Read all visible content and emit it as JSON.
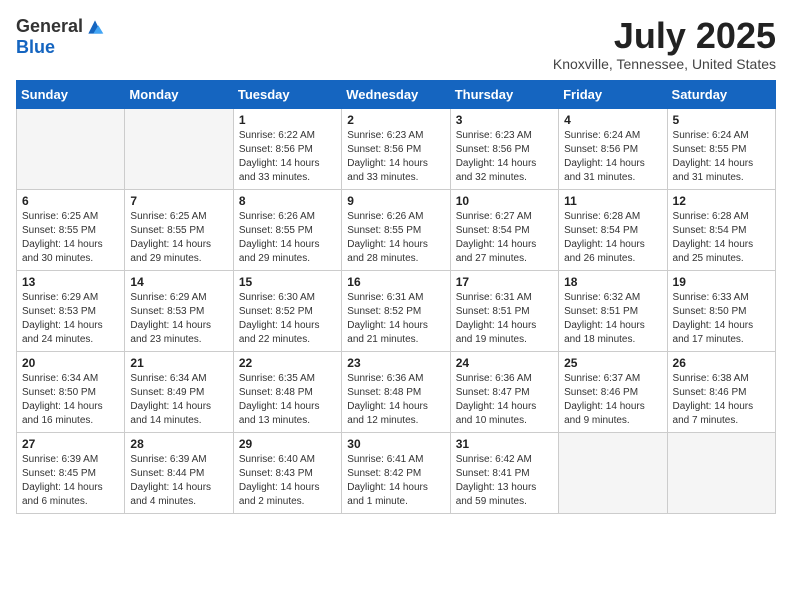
{
  "logo": {
    "general": "General",
    "blue": "Blue"
  },
  "title": "July 2025",
  "location": "Knoxville, Tennessee, United States",
  "weekdays": [
    "Sunday",
    "Monday",
    "Tuesday",
    "Wednesday",
    "Thursday",
    "Friday",
    "Saturday"
  ],
  "weeks": [
    [
      {
        "day": "",
        "empty": true
      },
      {
        "day": "",
        "empty": true
      },
      {
        "day": "1",
        "sunrise": "6:22 AM",
        "sunset": "8:56 PM",
        "daylight": "14 hours and 33 minutes."
      },
      {
        "day": "2",
        "sunrise": "6:23 AM",
        "sunset": "8:56 PM",
        "daylight": "14 hours and 33 minutes."
      },
      {
        "day": "3",
        "sunrise": "6:23 AM",
        "sunset": "8:56 PM",
        "daylight": "14 hours and 32 minutes."
      },
      {
        "day": "4",
        "sunrise": "6:24 AM",
        "sunset": "8:56 PM",
        "daylight": "14 hours and 31 minutes."
      },
      {
        "day": "5",
        "sunrise": "6:24 AM",
        "sunset": "8:55 PM",
        "daylight": "14 hours and 31 minutes."
      }
    ],
    [
      {
        "day": "6",
        "sunrise": "6:25 AM",
        "sunset": "8:55 PM",
        "daylight": "14 hours and 30 minutes."
      },
      {
        "day": "7",
        "sunrise": "6:25 AM",
        "sunset": "8:55 PM",
        "daylight": "14 hours and 29 minutes."
      },
      {
        "day": "8",
        "sunrise": "6:26 AM",
        "sunset": "8:55 PM",
        "daylight": "14 hours and 29 minutes."
      },
      {
        "day": "9",
        "sunrise": "6:26 AM",
        "sunset": "8:55 PM",
        "daylight": "14 hours and 28 minutes."
      },
      {
        "day": "10",
        "sunrise": "6:27 AM",
        "sunset": "8:54 PM",
        "daylight": "14 hours and 27 minutes."
      },
      {
        "day": "11",
        "sunrise": "6:28 AM",
        "sunset": "8:54 PM",
        "daylight": "14 hours and 26 minutes."
      },
      {
        "day": "12",
        "sunrise": "6:28 AM",
        "sunset": "8:54 PM",
        "daylight": "14 hours and 25 minutes."
      }
    ],
    [
      {
        "day": "13",
        "sunrise": "6:29 AM",
        "sunset": "8:53 PM",
        "daylight": "14 hours and 24 minutes."
      },
      {
        "day": "14",
        "sunrise": "6:29 AM",
        "sunset": "8:53 PM",
        "daylight": "14 hours and 23 minutes."
      },
      {
        "day": "15",
        "sunrise": "6:30 AM",
        "sunset": "8:52 PM",
        "daylight": "14 hours and 22 minutes."
      },
      {
        "day": "16",
        "sunrise": "6:31 AM",
        "sunset": "8:52 PM",
        "daylight": "14 hours and 21 minutes."
      },
      {
        "day": "17",
        "sunrise": "6:31 AM",
        "sunset": "8:51 PM",
        "daylight": "14 hours and 19 minutes."
      },
      {
        "day": "18",
        "sunrise": "6:32 AM",
        "sunset": "8:51 PM",
        "daylight": "14 hours and 18 minutes."
      },
      {
        "day": "19",
        "sunrise": "6:33 AM",
        "sunset": "8:50 PM",
        "daylight": "14 hours and 17 minutes."
      }
    ],
    [
      {
        "day": "20",
        "sunrise": "6:34 AM",
        "sunset": "8:50 PM",
        "daylight": "14 hours and 16 minutes."
      },
      {
        "day": "21",
        "sunrise": "6:34 AM",
        "sunset": "8:49 PM",
        "daylight": "14 hours and 14 minutes."
      },
      {
        "day": "22",
        "sunrise": "6:35 AM",
        "sunset": "8:48 PM",
        "daylight": "14 hours and 13 minutes."
      },
      {
        "day": "23",
        "sunrise": "6:36 AM",
        "sunset": "8:48 PM",
        "daylight": "14 hours and 12 minutes."
      },
      {
        "day": "24",
        "sunrise": "6:36 AM",
        "sunset": "8:47 PM",
        "daylight": "14 hours and 10 minutes."
      },
      {
        "day": "25",
        "sunrise": "6:37 AM",
        "sunset": "8:46 PM",
        "daylight": "14 hours and 9 minutes."
      },
      {
        "day": "26",
        "sunrise": "6:38 AM",
        "sunset": "8:46 PM",
        "daylight": "14 hours and 7 minutes."
      }
    ],
    [
      {
        "day": "27",
        "sunrise": "6:39 AM",
        "sunset": "8:45 PM",
        "daylight": "14 hours and 6 minutes."
      },
      {
        "day": "28",
        "sunrise": "6:39 AM",
        "sunset": "8:44 PM",
        "daylight": "14 hours and 4 minutes."
      },
      {
        "day": "29",
        "sunrise": "6:40 AM",
        "sunset": "8:43 PM",
        "daylight": "14 hours and 2 minutes."
      },
      {
        "day": "30",
        "sunrise": "6:41 AM",
        "sunset": "8:42 PM",
        "daylight": "14 hours and 1 minute."
      },
      {
        "day": "31",
        "sunrise": "6:42 AM",
        "sunset": "8:41 PM",
        "daylight": "13 hours and 59 minutes."
      },
      {
        "day": "",
        "empty": true
      },
      {
        "day": "",
        "empty": true
      }
    ]
  ]
}
